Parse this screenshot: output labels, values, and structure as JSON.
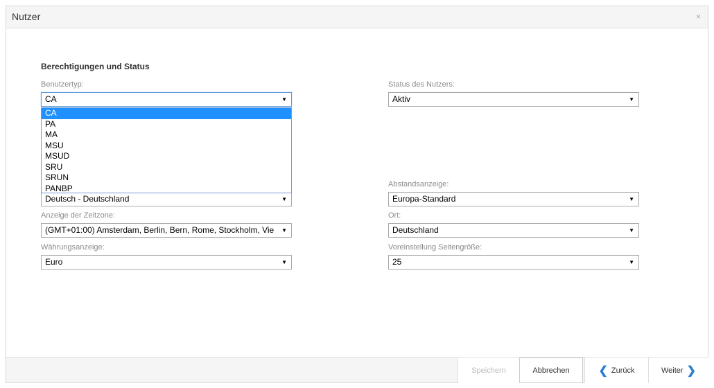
{
  "dialog": {
    "title": "Nutzer",
    "close_label": "×"
  },
  "section": {
    "title": "Berechtigungen und Status"
  },
  "fields": {
    "benutzertyp": {
      "label": "Benutzertyp:",
      "value": "CA"
    },
    "status": {
      "label": "Status des Nutzers:",
      "value": "Aktiv"
    },
    "sprache": {
      "value": "Deutsch - Deutschland"
    },
    "abstand": {
      "label": "Abstandsanzeige:",
      "value": "Europa-Standard"
    },
    "zeitzone": {
      "label": "Anzeige der Zeitzone:",
      "value": "(GMT+01:00) Amsterdam, Berlin, Bern, Rome, Stockholm, Vie"
    },
    "ort": {
      "label": "Ort:",
      "value": "Deutschland"
    },
    "waehrung": {
      "label": "Währungsanzeige:",
      "value": "Euro"
    },
    "seitengroesse": {
      "label": "Voreinstellung Seitengröße:",
      "value": "25"
    }
  },
  "dropdown_options": [
    "CA",
    "PA",
    "MA",
    "MSU",
    "MSUD",
    "SRU",
    "SRUN",
    "PANBP"
  ],
  "dropdown_selected": "CA",
  "footer": {
    "save_label": "Speichern",
    "cancel_label": "Abbrechen",
    "back_label": "Zurück",
    "next_label": "Weiter"
  },
  "colors": {
    "accent": "#2a7fd3",
    "selection": "#1e90ff"
  }
}
